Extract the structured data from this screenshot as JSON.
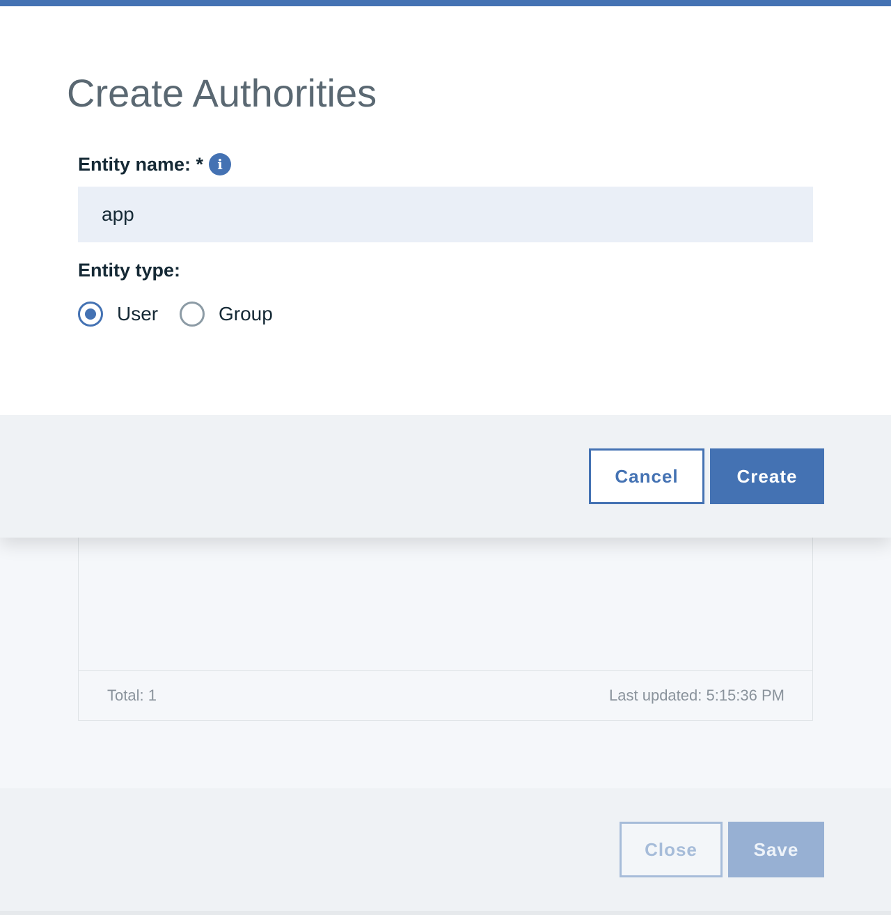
{
  "modal": {
    "title": "Create Authorities",
    "entity_name": {
      "label": "Entity name: *",
      "info_icon": "info-icon",
      "value": "app"
    },
    "entity_type": {
      "label": "Entity type:",
      "options": [
        {
          "label": "User",
          "checked": true
        },
        {
          "label": "Group",
          "checked": false
        }
      ]
    },
    "footer": {
      "cancel_label": "Cancel",
      "create_label": "Create"
    }
  },
  "background": {
    "table_footer": {
      "total": "Total: 1",
      "last_updated": "Last updated: 5:15:36 PM"
    },
    "footer": {
      "close_label": "Close",
      "save_label": "Save"
    }
  },
  "colors": {
    "accent": "#4472b3",
    "input_bg": "#eaeff7",
    "footer_bg": "#eff2f5",
    "title_text": "#5a6872",
    "label_text": "#152935",
    "disabled_accent": "#a6bcd9"
  }
}
